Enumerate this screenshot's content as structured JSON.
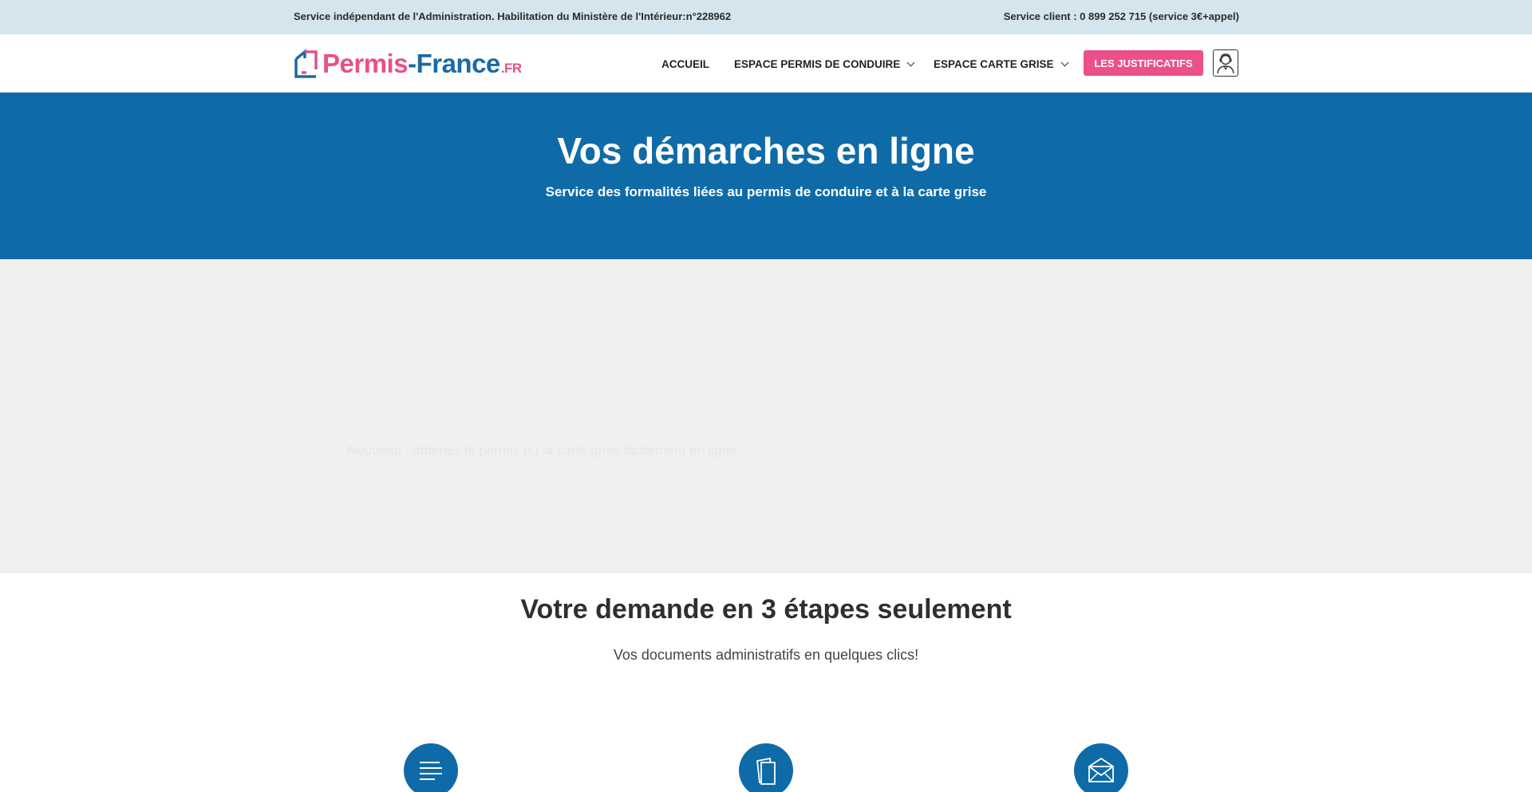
{
  "topbar": {
    "left_text": "Service indépendant de l'Administration. Habilitation du Ministère de l'Intérieur:n°228962",
    "right_text": "Service client : 0 899 252 715 (service 3€+appel)"
  },
  "header": {
    "logo": {
      "brand": "Permis",
      "dash_word": "-France",
      "tld": ".FR"
    },
    "nav": [
      {
        "label": "ACCUEIL"
      },
      {
        "label": "ESPACE PERMIS DE CONDUIRE"
      },
      {
        "label": "ESPACE CARTE GRISE"
      }
    ],
    "cta_label": "LES JUSTIFICATIFS",
    "account_icon": "user-support-icon"
  },
  "hero": {
    "title": "Vos démarches en ligne",
    "subtitle": "Service des formalités liées au permis de conduire et à la carte grise"
  },
  "grey_section": {
    "faint_text": "Nouveau : obtenez le permis ou la carte grise facilement en ligne"
  },
  "steps": {
    "title": "Votre demande en 3 étapes seulement",
    "subtitle": "Vos documents administratifs en quelques clics!",
    "icons": [
      "form-lines-icon",
      "documents-icon",
      "envelope-icon"
    ]
  },
  "colors": {
    "topbar_bg": "#d5e5ee",
    "primary_blue": "#0f6ba8",
    "accent_pink": "#eb4f8c",
    "section_grey": "#f0f0f0"
  }
}
